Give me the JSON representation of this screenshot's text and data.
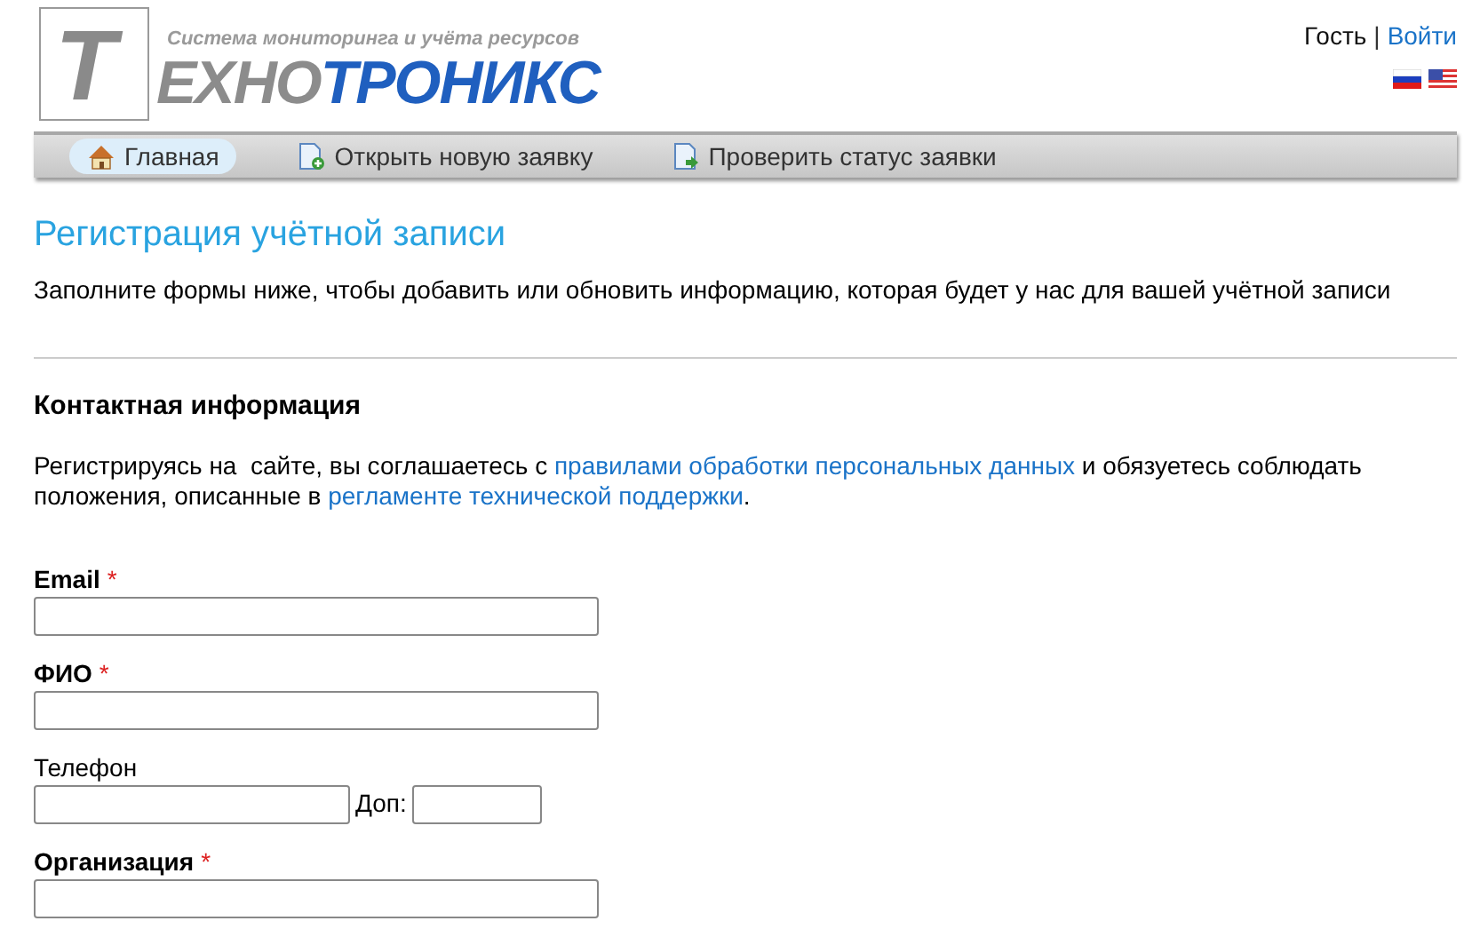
{
  "logo": {
    "initial": "Т",
    "grey_part": "ЕХНО",
    "blue_part": "ТРОНИКС",
    "tagline": "Система мониторинга и учёта ресурсов"
  },
  "user": {
    "name": "Гость",
    "separator": "|",
    "login": "Войти"
  },
  "languages": [
    {
      "kind": "ru"
    },
    {
      "kind": "us"
    }
  ],
  "nav": [
    {
      "label": "Главная",
      "selected": true
    },
    {
      "label": "Открыть новую заявку",
      "selected": false
    },
    {
      "label": "Проверить статус заявки",
      "selected": false
    }
  ],
  "title": "Регистрация учётной записи",
  "intro": "Заполните формы ниже, чтобы добавить или обновить информацию, которая будет у нас для вашей учётной записи",
  "section_title": "Контактная информация",
  "notice": [
    {
      "text": "Регистрируясь на  сайте, вы соглашаетесь с ",
      "link": false
    },
    {
      "text": "правилами обработки персональных данных",
      "link": true
    },
    {
      "text": " и обязуетесь соблюдать положения, описанные в ",
      "link": false
    },
    {
      "text": "регламенте технической поддержки",
      "link": true
    },
    {
      "text": ".",
      "link": false
    }
  ],
  "fields": [
    {
      "label": "Email",
      "required": true,
      "kind": "text"
    },
    {
      "label": "ФИО",
      "required": true,
      "kind": "text"
    },
    {
      "label": "Телефон",
      "required": false,
      "kind": "phone",
      "ext_label": "Доп:"
    },
    {
      "label": "Организация",
      "required": true,
      "kind": "text"
    }
  ],
  "required_mark": "*"
}
